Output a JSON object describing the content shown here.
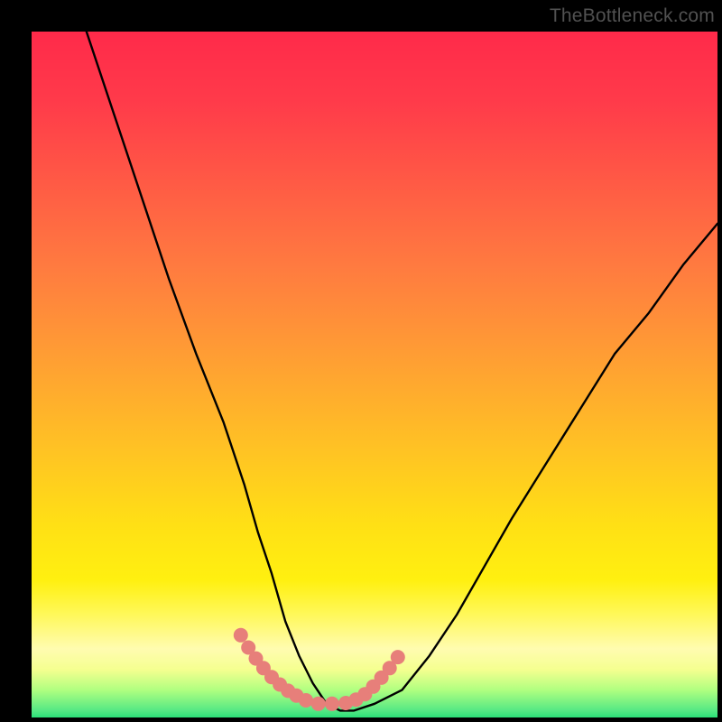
{
  "watermark": "TheBottleneck.com",
  "chart_data": {
    "type": "line",
    "title": "",
    "xlabel": "",
    "ylabel": "",
    "xlim": [
      0,
      100
    ],
    "ylim": [
      0,
      100
    ],
    "series": [
      {
        "name": "bottleneck-curve",
        "x": [
          8,
          12,
          16,
          20,
          24,
          28,
          31,
          33,
          35,
          37,
          39,
          41,
          43,
          45,
          47,
          50,
          54,
          58,
          62,
          66,
          70,
          75,
          80,
          85,
          90,
          95,
          100
        ],
        "values": [
          100,
          88,
          76,
          64,
          53,
          43,
          34,
          27,
          21,
          14,
          9,
          5,
          2,
          1,
          1,
          2,
          4,
          9,
          15,
          22,
          29,
          37,
          45,
          53,
          59,
          66,
          72
        ]
      }
    ],
    "markers": {
      "name": "highlight-dots",
      "x": [
        30.5,
        31.6,
        32.7,
        33.8,
        35.0,
        36.2,
        37.4,
        38.6,
        40.0,
        41.8,
        43.8,
        45.8,
        47.3,
        48.6,
        49.8,
        51.0,
        52.2,
        53.4
      ],
      "y": [
        12.0,
        10.2,
        8.6,
        7.2,
        5.9,
        4.8,
        3.9,
        3.2,
        2.5,
        2.0,
        2.0,
        2.1,
        2.6,
        3.4,
        4.5,
        5.8,
        7.2,
        8.8
      ],
      "color": "#e77f7a",
      "radius_px": 8
    },
    "background": {
      "type": "vertical-gradient",
      "stops": [
        {
          "pos": 0.0,
          "color": "#ff2a4a"
        },
        {
          "pos": 0.5,
          "color": "#ffa030"
        },
        {
          "pos": 0.8,
          "color": "#ffee20"
        },
        {
          "pos": 1.0,
          "color": "#2be078"
        }
      ]
    }
  }
}
